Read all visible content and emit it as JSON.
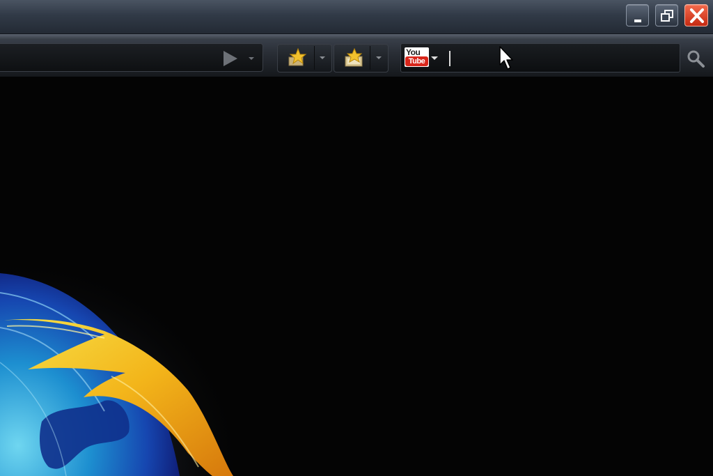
{
  "window": {
    "minimize_icon": "minimize-icon",
    "restore_icon": "restore-icon",
    "close_icon": "close-icon",
    "close_color": "#e0391c"
  },
  "toolbar": {
    "go_icon": "play-arrow-icon",
    "bookmark_star_icon": "star-icon",
    "bookmark_manager_icon": "star-folder-icon",
    "search_icon": "magnifier-icon"
  },
  "search": {
    "engine_logo_line1": "You",
    "engine_logo_line2": "Tube",
    "value": ""
  },
  "colors": {
    "accent_youtube_red": "#d8261b",
    "background": "#050505"
  }
}
